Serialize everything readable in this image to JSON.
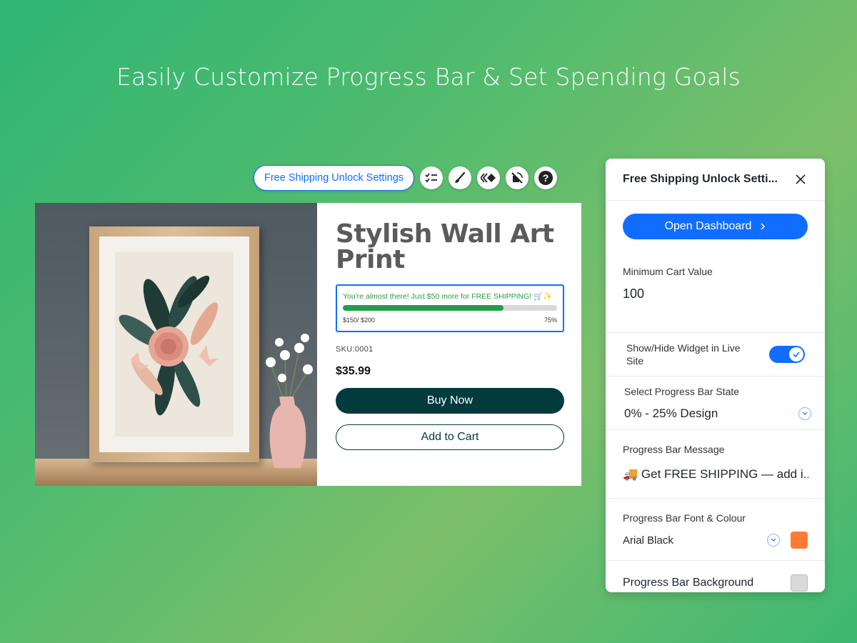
{
  "headline": "Easily Customize Progress Bar & Set Spending Goals",
  "toolbar": {
    "settings_label": "Free Shipping Unlock Settings",
    "icons": [
      "checklist-icon",
      "brush-icon",
      "animation-icon",
      "no-signal-icon",
      "help-icon"
    ]
  },
  "product": {
    "title": "Stylish Wall Art Print",
    "progress_widget": {
      "message": "You're almost there! Just $50 more for FREE SHIPPING! 🛒✨",
      "progress_fraction": 0.75,
      "amount_text": "$150/ $200",
      "percent_text": "75%",
      "fill_color": "#229c4c",
      "track_color": "#d9d9d9"
    },
    "sku": "SKU:0001",
    "price": "$35.99",
    "buy_label": "Buy Now",
    "cart_label": "Add to Cart"
  },
  "panel": {
    "title": "Free Shipping Unlock Setti...",
    "open_dashboard": "Open Dashboard",
    "min_cart_label": "Minimum Cart Value",
    "min_cart_value": "100",
    "show_hide_label": "Show/Hide Widget in Live Site",
    "show_hide_on": true,
    "state_label": "Select Progress Bar State",
    "state_value": "0% - 25% Design",
    "message_label": "Progress Bar Message",
    "message_value": "🚚 Get FREE SHIPPING — add i...",
    "font_label": "Progress Bar Font & Colour",
    "font_value": "Arial Black",
    "font_color": "#ff7a35",
    "bg_label": "Progress Bar Background",
    "bg_color": "#d9d9d9"
  },
  "colors": {
    "accent": "#116dff",
    "button_dark": "#013b3e"
  }
}
